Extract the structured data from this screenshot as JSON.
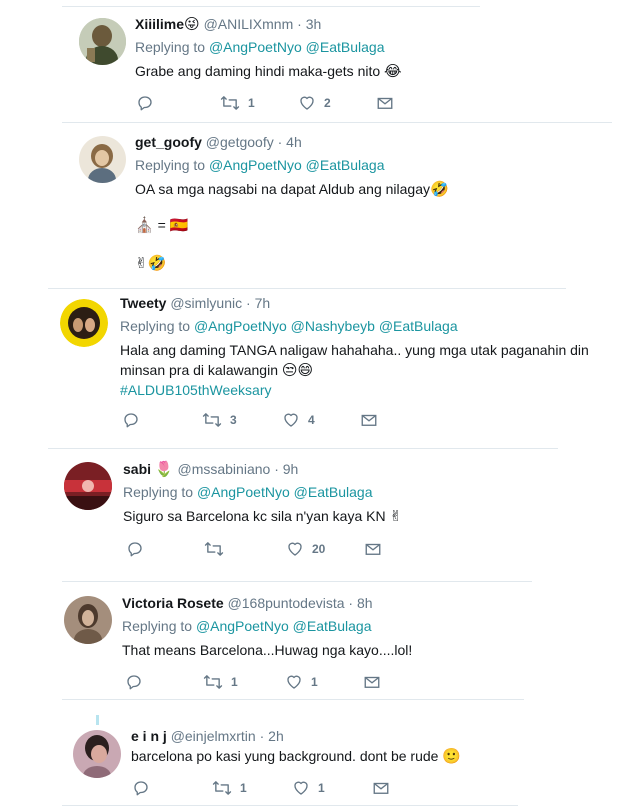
{
  "tweets": [
    {
      "name": "Xiiilime",
      "name_emoji": "😜",
      "handle": "@ANILIXmnm",
      "dot": "·",
      "time": "3h",
      "replying": "Replying to",
      "mentions": [
        "@AngPoetNyo",
        "@EatBulaga"
      ],
      "text": "Grabe ang daming hindi maka-gets nito",
      "text_emoji": "😂",
      "retweets": "1",
      "likes": "2"
    },
    {
      "name": "get_goofy",
      "handle": "@getgoofy",
      "dot": "·",
      "time": "4h",
      "replying": "Replying to",
      "mentions": [
        "@AngPoetNyo",
        "@EatBulaga"
      ],
      "text": "OA sa mga nagsabi na dapat Aldub ang nilagay",
      "text_emoji": "🤣",
      "line2_a": "⛪",
      "line2_eq": "=",
      "line2_b": "🇪🇸",
      "line3": "✌🤣",
      "retweets": "",
      "likes": ""
    },
    {
      "name": "Tweety",
      "handle": "@simlyunic",
      "dot": "·",
      "time": "7h",
      "replying": "Replying to",
      "mentions": [
        "@AngPoetNyo",
        "@Nashybeyb",
        "@EatBulaga"
      ],
      "text": "Hala ang daming TANGA naligaw hahahaha.. yung mga utak paganahin din minsan pra di kalawangin",
      "text_emoji": "😒😄",
      "hashtag": "#ALDUB105thWeeksary",
      "retweets": "3",
      "likes": "4"
    },
    {
      "name": "sabi",
      "name_emoji": "🌷",
      "handle": "@mssabiniano",
      "dot": "·",
      "time": "9h",
      "replying": "Replying to",
      "mentions": [
        "@AngPoetNyo",
        "@EatBulaga"
      ],
      "text": "Siguro sa Barcelona kc sila n'yan kaya KN",
      "text_emoji": "✌",
      "retweets": "",
      "likes": "20"
    },
    {
      "name": "Victoria Rosete",
      "handle": "@168puntodevista",
      "dot": "·",
      "time": "8h",
      "replying": "Replying to",
      "mentions": [
        "@AngPoetNyo",
        "@EatBulaga"
      ],
      "text": "That means Barcelona...Huwag nga kayo....lol!",
      "retweets": "1",
      "likes": "1"
    },
    {
      "name": "e i n j",
      "handle": "@einjelmxrtin",
      "dot": "·",
      "time": "2h",
      "text": "barcelona po kasi yung background. dont be rude",
      "text_emoji": "🙂",
      "retweets": "1",
      "likes": "1"
    }
  ],
  "icons": {
    "reply": "reply-icon",
    "retweet": "retweet-icon",
    "like": "heart-icon",
    "dm": "envelope-icon"
  },
  "colors": {
    "mention": "#1b95a0",
    "secondary": "#657786",
    "divider": "#e1e8ed"
  }
}
